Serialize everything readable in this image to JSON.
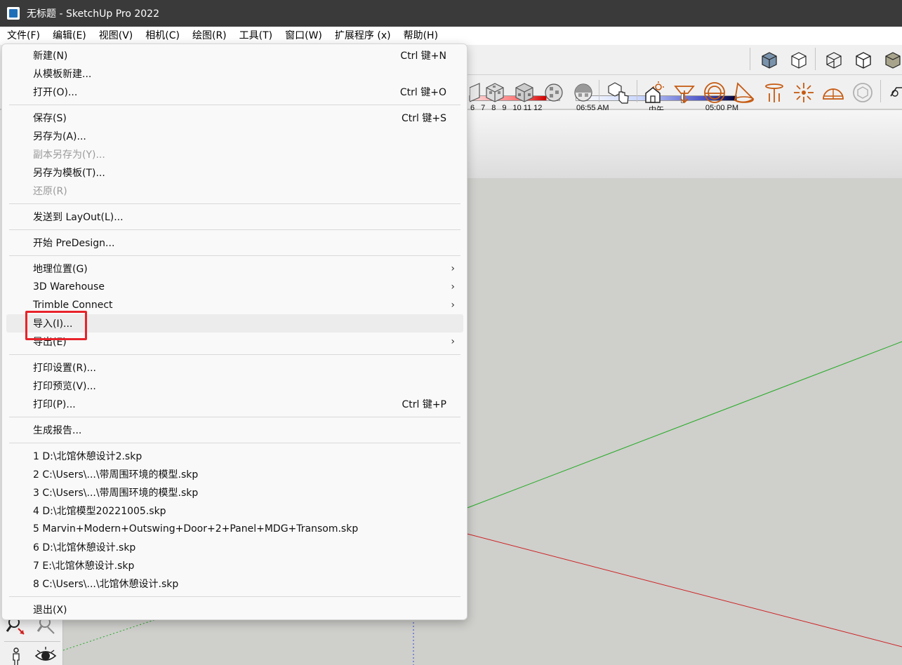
{
  "window": {
    "title": "无标题 - SketchUp Pro 2022"
  },
  "menubar": {
    "items": [
      "文件(F)",
      "编辑(E)",
      "视图(V)",
      "相机(C)",
      "绘图(R)",
      "工具(T)",
      "窗口(W)",
      "扩展程序 (x)",
      "帮助(H)"
    ]
  },
  "shadow": {
    "months": [
      "6",
      "7",
      "8",
      "9",
      "10",
      "11",
      "12"
    ]
  },
  "time": {
    "start": "06:55 AM",
    "mid": "中午",
    "end": "05:00 PM"
  },
  "file_menu": {
    "new": {
      "label": "新建(N)",
      "shortcut": "Ctrl 键+N"
    },
    "new_from_template": {
      "label": "从模板新建..."
    },
    "open": {
      "label": "打开(O)...",
      "shortcut": "Ctrl 键+O"
    },
    "save": {
      "label": "保存(S)",
      "shortcut": "Ctrl 键+S"
    },
    "save_as": {
      "label": "另存为(A)..."
    },
    "save_copy_as": {
      "label": "副本另存为(Y)..."
    },
    "save_as_template": {
      "label": "另存为模板(T)..."
    },
    "revert": {
      "label": "还原(R)"
    },
    "send_to_layout": {
      "label": "发送到 LayOut(L)..."
    },
    "predesign": {
      "label": "开始 PreDesign..."
    },
    "geo_location": {
      "label": "地理位置(G)"
    },
    "warehouse": {
      "label": "3D Warehouse"
    },
    "trimble_connect": {
      "label": "Trimble Connect"
    },
    "import": {
      "label": "导入(I)..."
    },
    "export": {
      "label": "导出(E)"
    },
    "print_setup": {
      "label": "打印设置(R)..."
    },
    "print_preview": {
      "label": "打印预览(V)..."
    },
    "print": {
      "label": "打印(P)...",
      "shortcut": "Ctrl 键+P"
    },
    "report": {
      "label": "生成报告..."
    },
    "recent": [
      "1 D:\\北馆休憩设计2.skp",
      "2 C:\\Users\\...\\带周围环境的模型.skp",
      "3 C:\\Users\\...\\带周围环境的模型.skp",
      "4 D:\\北馆模型20221005.skp",
      "5 Marvin+Modern+Outswing+Door+2+Panel+MDG+Transom.skp",
      "6 D:\\北馆休憩设计.skp",
      "7 E:\\北馆休憩设计.skp",
      "8 C:\\Users\\...\\北馆休憩设计.skp"
    ],
    "exit": {
      "label": "退出(X)"
    },
    "submenu_arrow": "›"
  },
  "colors": {
    "highlight": "#e8232a",
    "green_axis": "#22aa22",
    "red_axis": "#cc2222"
  }
}
